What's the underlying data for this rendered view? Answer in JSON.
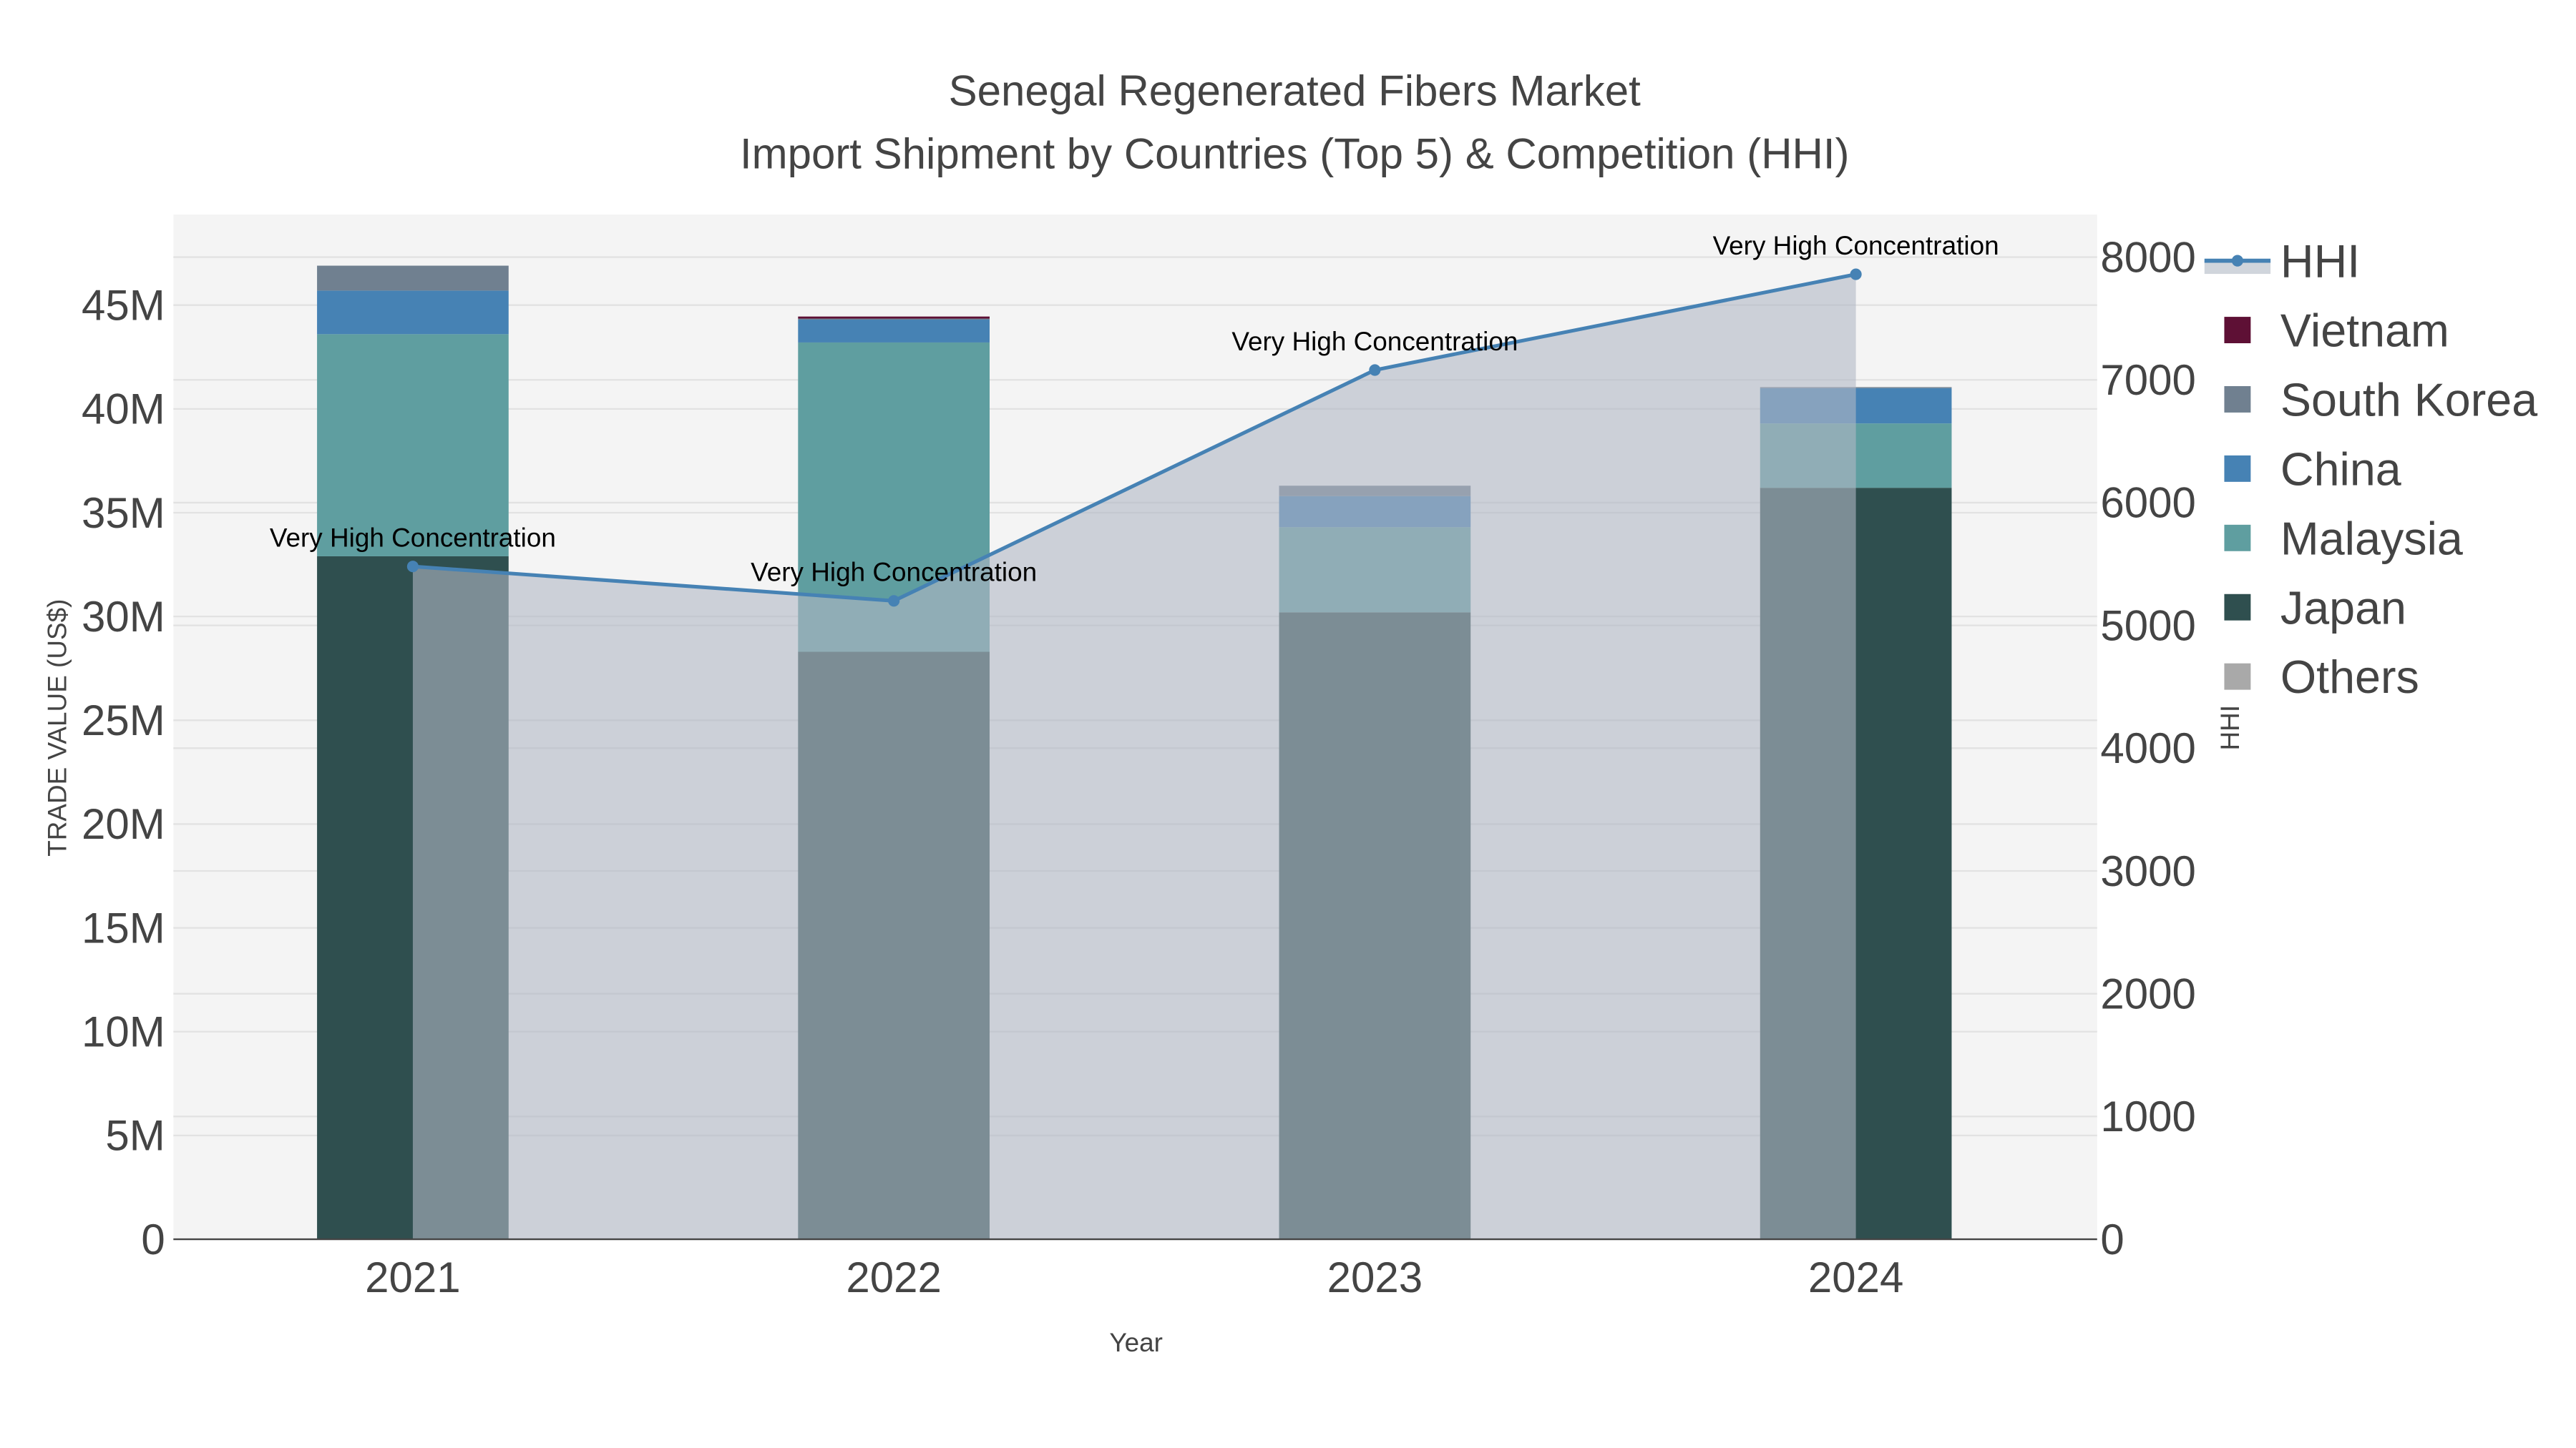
{
  "chart_data": {
    "type": "bar",
    "stacked": true,
    "title": "Senegal Regenerated Fibers Market",
    "subtitle": "Import Shipment by Countries (Top 5) & Competition (HHI)",
    "xlabel": "Year",
    "ylabel": "TRADE VALUE (US$)",
    "y2label": "HHI",
    "categories": [
      "2021",
      "2022",
      "2023",
      "2024"
    ],
    "ylim": [
      0,
      48000000
    ],
    "y_ticks": [
      0,
      5000000,
      10000000,
      15000000,
      20000000,
      25000000,
      30000000,
      35000000,
      40000000,
      45000000
    ],
    "y_tick_labels": [
      "0",
      "5M",
      "10M",
      "15M",
      "20M",
      "25M",
      "30M",
      "35M",
      "40M",
      "45M"
    ],
    "y2lim": [
      0,
      8350
    ],
    "y2_ticks": [
      0,
      1000,
      2000,
      3000,
      4000,
      5000,
      6000,
      7000,
      8000
    ],
    "y2_tick_labels": [
      "0",
      "1000",
      "2000",
      "3000",
      "4000",
      "5000",
      "6000",
      "7000",
      "8000"
    ],
    "grid": true,
    "legend_placement": "right",
    "series": [
      {
        "name": "Japan",
        "color": "#2f4f4f",
        "values": [
          32900000,
          28300000,
          30200000,
          36200000
        ]
      },
      {
        "name": "Malaysia",
        "color": "#5f9ea0",
        "values": [
          10700000,
          14900000,
          4100000,
          3100000
        ]
      },
      {
        "name": "China",
        "color": "#4682b4",
        "values": [
          2100000,
          1100000,
          1500000,
          1700000
        ]
      },
      {
        "name": "South Korea",
        "color": "#708090",
        "values": [
          1200000,
          50000,
          500000,
          50000
        ]
      },
      {
        "name": "Vietnam",
        "color": "#5e1035",
        "values": [
          0,
          100000,
          0,
          0
        ]
      },
      {
        "name": "Others",
        "color": "#a9a9a9",
        "values": [
          0,
          0,
          0,
          0
        ]
      }
    ],
    "line_series": {
      "name": "HHI",
      "color": "#4682b4",
      "fill": "rgba(176,184,196,0.6)",
      "values": [
        5480,
        5200,
        7080,
        7860
      ],
      "annotations": [
        "Very High Concentration",
        "Very High Concentration",
        "Very High Concentration",
        "Very High Concentration"
      ]
    },
    "legend_order": [
      "HHI",
      "Vietnam",
      "South Korea",
      "China",
      "Malaysia",
      "Japan",
      "Others"
    ]
  }
}
